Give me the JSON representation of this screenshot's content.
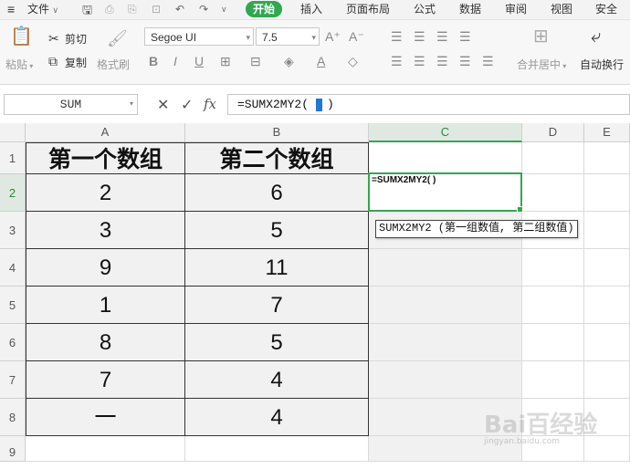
{
  "menu": {
    "hamburger_icon": "hamburger-icon",
    "file_label": "文件",
    "start_label": "开始",
    "items": [
      "插入",
      "页面布局",
      "公式",
      "数据",
      "审阅",
      "视图",
      "安全"
    ]
  },
  "ribbon": {
    "paste_label": "粘贴",
    "cut_label": "剪切",
    "copy_label": "复制",
    "format_painter_label": "格式刷",
    "font_name": "Segoe UI",
    "font_size": "7.5",
    "merge_label": "合并居中",
    "wrap_label": "自动换行"
  },
  "formula_bar": {
    "name_box": "SUM",
    "fx_label": "fx",
    "formula_prefix": "=SUMX2MY2(",
    "formula_suffix": ")"
  },
  "columns": [
    "A",
    "B",
    "C",
    "D",
    "E"
  ],
  "rows": [
    "1",
    "2",
    "3",
    "4",
    "5",
    "6",
    "7",
    "8",
    "9"
  ],
  "table": {
    "headers": [
      "第一个数组",
      "第二个数组"
    ],
    "col_a": [
      "2",
      "3",
      "9",
      "1",
      "8",
      "7",
      "一"
    ],
    "col_b": [
      "6",
      "5",
      "11",
      "7",
      "5",
      "4",
      "4"
    ]
  },
  "active_cell_text": "=SUMX2MY2( )",
  "tooltip": "SUMX2MY2 (第一组数值, 第二组数值)",
  "watermark": {
    "brand": "Bai百经验",
    "url": "jingyan.baidu.com"
  },
  "colors": {
    "accent": "#2fa94f",
    "cursor": "#1e78d7"
  }
}
